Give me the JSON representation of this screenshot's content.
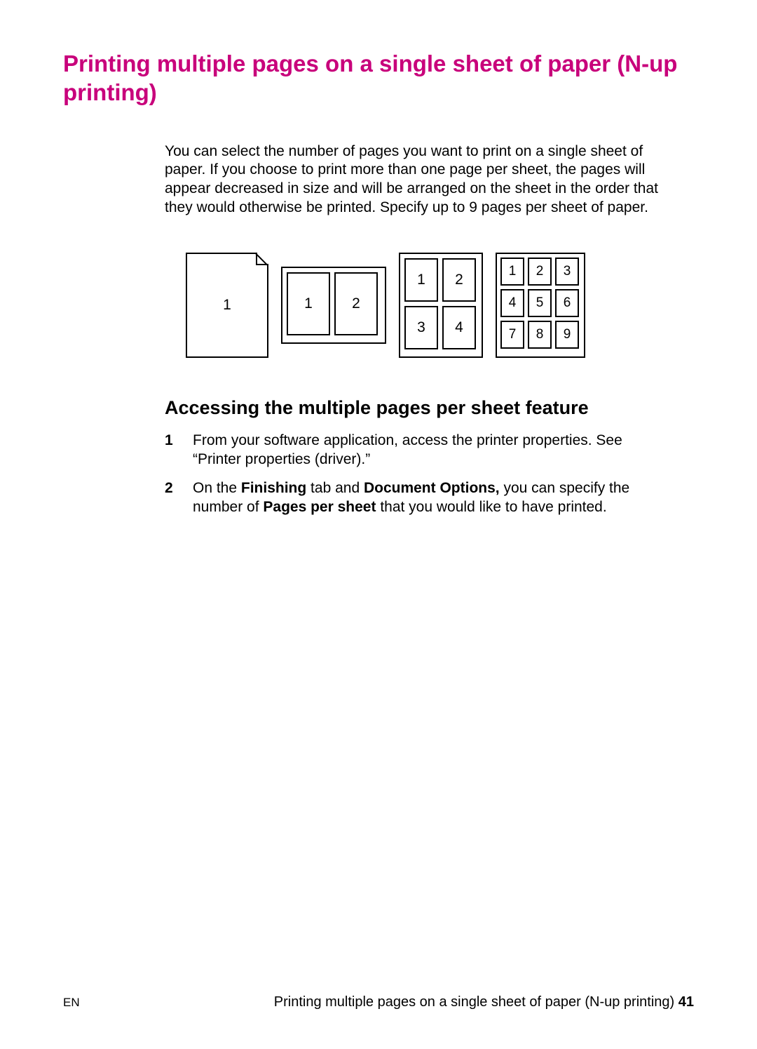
{
  "title": "Printing multiple pages on a single sheet of paper (N-up printing)",
  "intro": "You can select the number of pages you want to print on a single sheet of paper. If you choose to print more than one page per sheet, the pages will appear decreased in size and will be arranged on the sheet in the order that they would otherwise be printed. Specify up to 9 pages per sheet of paper.",
  "diagram": {
    "one": "1",
    "two": [
      "1",
      "2"
    ],
    "four": [
      "1",
      "2",
      "3",
      "4"
    ],
    "nine": [
      "1",
      "2",
      "3",
      "4",
      "5",
      "6",
      "7",
      "8",
      "9"
    ]
  },
  "subheading": "Accessing the multiple pages per sheet feature",
  "steps": {
    "s1": {
      "num": "1",
      "text": "From your software application, access the printer properties. See “Printer properties (driver).”"
    },
    "s2": {
      "num": "2",
      "pre": "On the ",
      "b1": "Finishing",
      "mid1": " tab and ",
      "b2": "Document Options,",
      "mid2": " you can specify the number of ",
      "b3": "Pages per sheet",
      "post": " that you would like to have printed."
    }
  },
  "footer": {
    "lang": "EN",
    "label": "Printing multiple pages on a single sheet of paper (N-up printing) ",
    "page": "41"
  }
}
